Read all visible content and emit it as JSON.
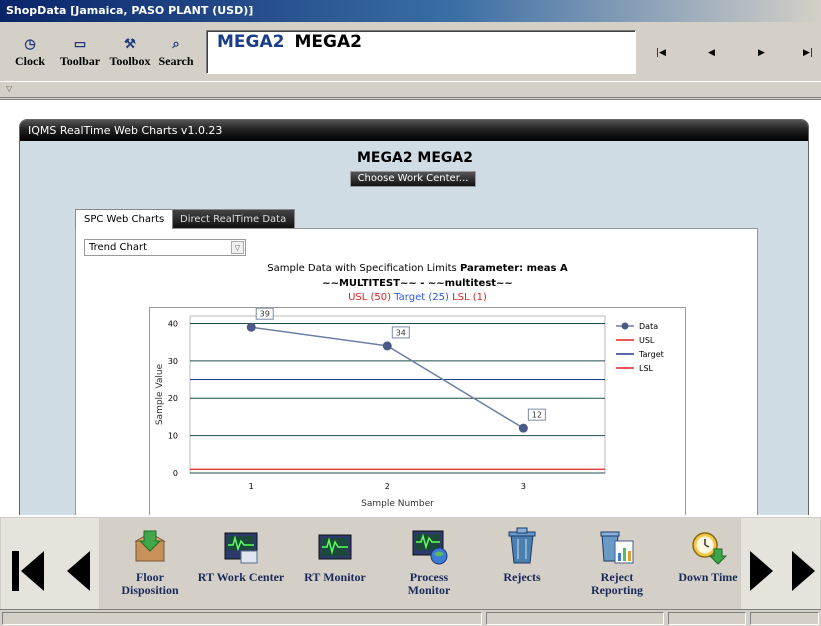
{
  "window": {
    "title": "ShopData [Jamaica, PASO PLANT (USD)]"
  },
  "toolbar": {
    "buttons": [
      {
        "label": "Clock",
        "icon": "clock-icon"
      },
      {
        "label": "Toolbar",
        "icon": "toolbar-icon"
      },
      {
        "label": "Toolbox",
        "icon": "toolbox-icon"
      },
      {
        "label": "Search",
        "icon": "binoculars-icon"
      }
    ],
    "work_center_code": "MEGA2",
    "work_center_name": "MEGA2",
    "nav": {
      "first": "|◀",
      "prev": "◀",
      "next": "▶",
      "last": "▶|"
    }
  },
  "panel": {
    "title": "IQMS RealTime Web Charts v1.0.23",
    "work_center_heading": "MEGA2 MEGA2",
    "choose_button": "Choose Work Center...",
    "tabs": [
      {
        "label": "SPC Web Charts",
        "active": true
      },
      {
        "label": "Direct RealTime Data",
        "active": false
      }
    ],
    "chart_select": "Trend Chart",
    "caption_line1_prefix": "Sample Data with Specification Limits ",
    "caption_line1_bold": "Parameter: meas A",
    "caption_line2": "~~MULTITEST~~ - ~~multitest~~",
    "usl_label": "USL (50)",
    "target_label": "Target (25)",
    "lsl_label": "LSL (1)"
  },
  "colors": {
    "data_line": "#6c7fa3",
    "data_point": "#4a5a86",
    "usl": "#e02020",
    "target": "#1e3a8a",
    "lsl": "#e02020",
    "usl_text": "#e02020",
    "target_text": "#2a5bd7",
    "grid": "#1f4d4d"
  },
  "chart_data": {
    "type": "line",
    "x": [
      1,
      2,
      3
    ],
    "series": [
      {
        "name": "Data",
        "values": [
          39,
          34,
          12
        ]
      }
    ],
    "usl": 50,
    "target": 25,
    "lsl": 1,
    "xlabel": "Sample Number",
    "ylabel": "Sample Value",
    "yticks": [
      0,
      10,
      20,
      30,
      40
    ],
    "xticks": [
      1,
      2,
      3
    ],
    "ylim": [
      0,
      42
    ],
    "xlim": [
      0.55,
      3.6
    ],
    "legend": [
      "Data",
      "USL",
      "Target",
      "LSL"
    ],
    "legend_position": "right",
    "data_labels": [
      "39",
      "34",
      "12"
    ]
  },
  "bottom": {
    "items": [
      {
        "label1": "Floor",
        "label2": "Disposition",
        "icon": "floor-disposition-icon"
      },
      {
        "label1": "RT Work Center",
        "label2": "",
        "icon": "rt-work-center-icon"
      },
      {
        "label1": "RT Monitor",
        "label2": "",
        "icon": "rt-monitor-icon"
      },
      {
        "label1": "Process",
        "label2": "Monitor",
        "icon": "process-monitor-icon"
      },
      {
        "label1": "Rejects",
        "label2": "",
        "icon": "rejects-icon"
      },
      {
        "label1": "Reject",
        "label2": "Reporting",
        "icon": "reject-reporting-icon"
      },
      {
        "label1": "Down Time",
        "label2": "",
        "icon": "down-time-icon"
      }
    ]
  }
}
